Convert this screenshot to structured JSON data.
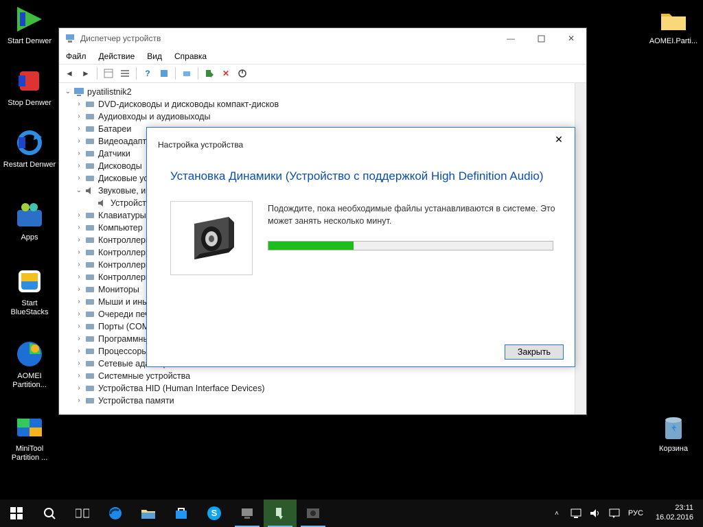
{
  "desktop_icons_left": [
    {
      "label": "Start Denwer",
      "kind": "denwer-start"
    },
    {
      "label": "Stop Denwer",
      "kind": "denwer-stop"
    },
    {
      "label": "Restart Denwer",
      "kind": "denwer-restart"
    },
    {
      "label": "Apps",
      "kind": "apps"
    },
    {
      "label": "Start BlueStacks",
      "kind": "bluestacks"
    },
    {
      "label": "AOMEI Partition...",
      "kind": "aomei"
    },
    {
      "label": "MiniTool Partition ...",
      "kind": "minitool"
    }
  ],
  "desktop_icons_right": [
    {
      "label": "AOMEI.Parti...",
      "kind": "folder"
    },
    {
      "label": "Корзина",
      "kind": "recycle"
    }
  ],
  "device_manager": {
    "title": "Диспетчер устройств",
    "menus": [
      "Файл",
      "Действие",
      "Вид",
      "Справка"
    ],
    "root": "pyatilistnik2",
    "items": [
      "DVD-дисководы и дисководы компакт-дисков",
      "Аудиовходы и аудиовыходы",
      "Батареи",
      "Видеоадаптеры",
      "Датчики",
      "Дисководы",
      "Дисковые устройства",
      "Звуковые, игровые и видеоустройства",
      "Устройство с поддержкой High Definition...",
      "Клавиатуры",
      "Компьютер",
      "Контроллеры IDE ATA/ATAPI",
      "Контроллеры USB",
      "Контроллеры запоминающих устройств",
      "Контроллеры IDE",
      "Мониторы",
      "Мыши и иные указывающие устройства",
      "Очереди печати",
      "Порты (COM и LPT)",
      "Программные устройства",
      "Процессоры",
      "Сетевые адаптеры",
      "Системные устройства",
      "Устройства HID (Human Interface Devices)",
      "Устройства памяти"
    ]
  },
  "dialog": {
    "subtitle": "Настройка устройства",
    "heading": "Установка Динамики (Устройство с поддержкой High Definition Audio)",
    "body": "Подождите, пока необходимые файлы устанавливаются в системе. Это может занять несколько минут.",
    "progress_percent": 30,
    "close_btn": "Закрыть"
  },
  "taskbar": {
    "lang": "РУС",
    "time": "23:11",
    "date": "16.02.2016"
  }
}
